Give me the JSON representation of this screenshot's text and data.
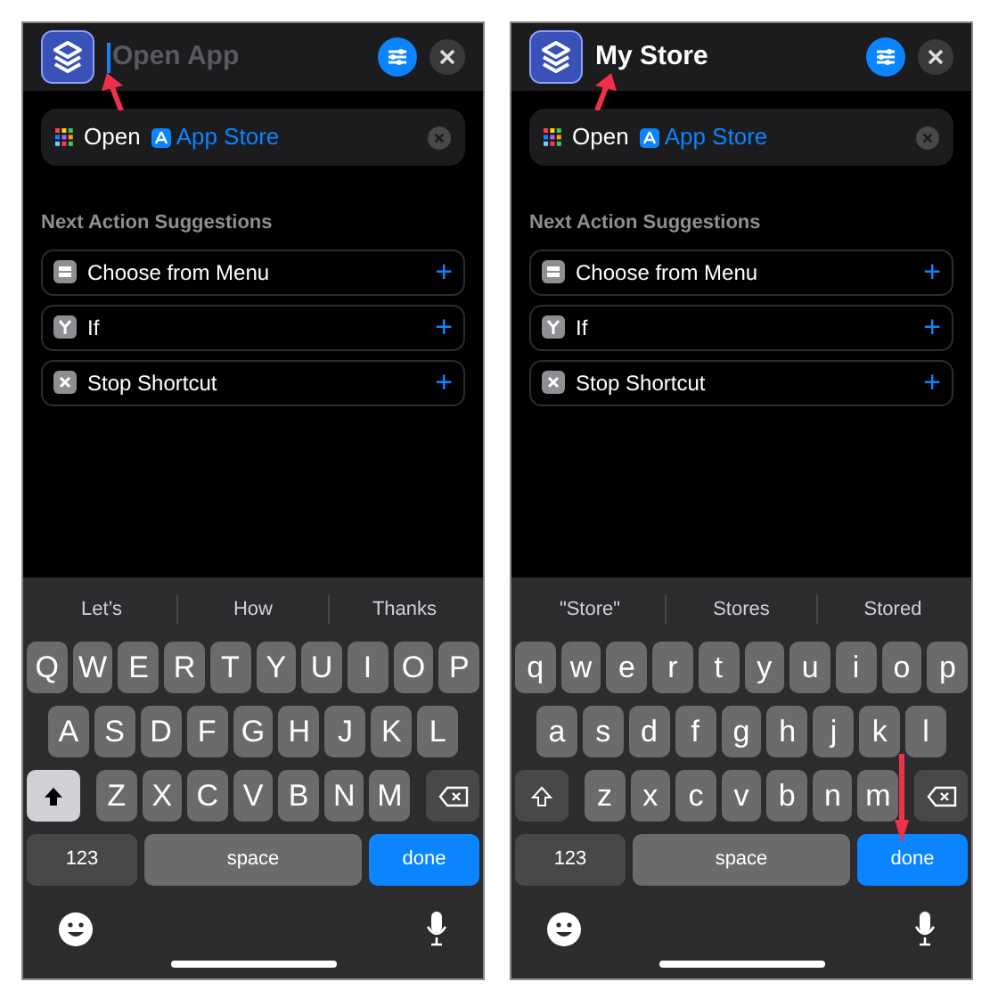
{
  "panels": [
    {
      "title": {
        "placeholder": "Open App"
      },
      "action": {
        "verb": "Open",
        "app": "App Store"
      },
      "section": "Next Action Suggestions",
      "suggestions": [
        {
          "kind": "menu",
          "label": "Choose from Menu",
          "add": "+"
        },
        {
          "kind": "if",
          "label": "If",
          "add": "+"
        },
        {
          "kind": "stop",
          "label": "Stop Shortcut",
          "add": "+"
        }
      ],
      "predictions": [
        "Let’s",
        "How",
        "Thanks"
      ],
      "rows": [
        [
          "Q",
          "W",
          "E",
          "R",
          "T",
          "Y",
          "U",
          "I",
          "O",
          "P"
        ],
        [
          "A",
          "S",
          "D",
          "F",
          "G",
          "H",
          "J",
          "K",
          "L"
        ],
        [
          "Z",
          "X",
          "C",
          "V",
          "B",
          "N",
          "M"
        ]
      ],
      "shift_on": true,
      "numbers": "123",
      "space": "space",
      "done": "done"
    },
    {
      "title": {
        "value": "My Store"
      },
      "action": {
        "verb": "Open",
        "app": "App Store"
      },
      "section": "Next Action Suggestions",
      "suggestions": [
        {
          "kind": "menu",
          "label": "Choose from Menu",
          "add": "+"
        },
        {
          "kind": "if",
          "label": "If",
          "add": "+"
        },
        {
          "kind": "stop",
          "label": "Stop Shortcut",
          "add": "+"
        }
      ],
      "predictions": [
        "\"Store\"",
        "Stores",
        "Stored"
      ],
      "rows": [
        [
          "q",
          "w",
          "e",
          "r",
          "t",
          "y",
          "u",
          "i",
          "o",
          "p"
        ],
        [
          "a",
          "s",
          "d",
          "f",
          "g",
          "h",
          "j",
          "k",
          "l"
        ],
        [
          "z",
          "x",
          "c",
          "v",
          "b",
          "n",
          "m"
        ]
      ],
      "shift_on": false,
      "numbers": "123",
      "space": "space",
      "done": "done"
    }
  ]
}
